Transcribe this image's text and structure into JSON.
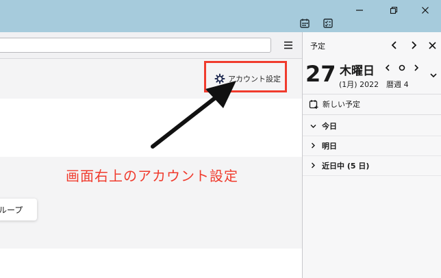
{
  "window": {
    "controls": [
      "minimize",
      "restore",
      "close"
    ]
  },
  "titlebar_icons": [
    "calendar-icon",
    "tasks-icon"
  ],
  "toolbar": {
    "search_value": "",
    "menu_icon": "hamburger-icon"
  },
  "main": {
    "account_settings_label": "アカウント設定",
    "group_chip_label": "ループ",
    "annotation_text": "画面右上のアカウント設定",
    "highlight_color": "#f03b2d"
  },
  "sidebar": {
    "title": "予定",
    "day_number": "27",
    "weekday": "木曜日",
    "date_line": "(1月) 2022　暦週 4",
    "new_event_label": "新しい予定",
    "agenda": [
      {
        "label": "今日",
        "expanded": true
      },
      {
        "label": "明日",
        "expanded": false
      },
      {
        "label": "近日中 (5 日)",
        "expanded": false
      }
    ]
  }
}
